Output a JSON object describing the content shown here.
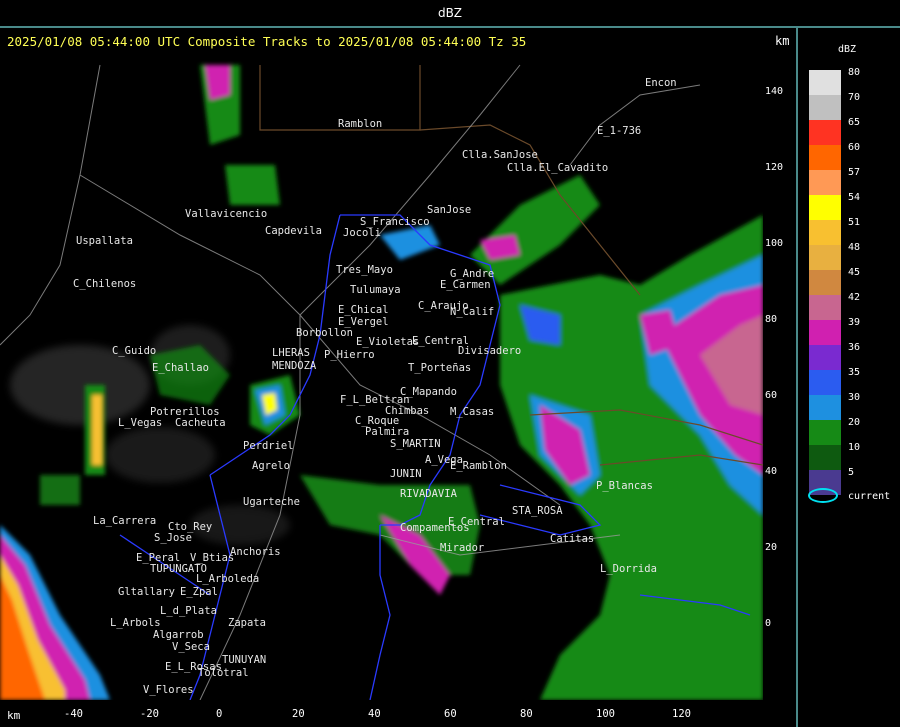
{
  "window": {
    "title": "dBZ"
  },
  "map": {
    "title": "2025/01/08 05:44:00 UTC Composite Tracks to 2025/01/08 05:44:00 Tz 35",
    "unit_label": "km",
    "x_axis_unit": "km",
    "y_ticks": [
      "140",
      "120",
      "100",
      "80",
      "60",
      "40",
      "20",
      "0"
    ],
    "x_ticks": [
      "-40",
      "-20",
      "0",
      "20",
      "40",
      "60",
      "80",
      "100",
      "120"
    ],
    "places": [
      "Ramblon",
      "Encon",
      "E_1-736",
      "Clla.SanJose",
      "Clla.El_Cavadito",
      "S_Francisco",
      "SanJose",
      "Uspallata",
      "Vallavicencio",
      "Capdevila",
      "Jocoli",
      "Tres_Mayo",
      "G_Andre",
      "E_Carmen",
      "Tulumaya",
      "C_Chilenos",
      "E_Chical",
      "E_Vergel",
      "C_Araujo",
      "N_Calif",
      "Borbollon",
      "E_Violetas",
      "E_Central",
      "Divisadero",
      "C_Guido",
      "LHERAS",
      "P_Hierro",
      "E_Challao",
      "MENDOZA",
      "T_Porteñas",
      "C_Mapando",
      "F_L_Beltran",
      "Potrerillos",
      "Chimbas",
      "M_Casas",
      "L_Vegas",
      "Cacheuta",
      "C_Roque",
      "Palmira",
      "Perdriel",
      "S_MARTIN",
      "Agrelo",
      "A_Vega",
      "E_Ramblon",
      "JUNIN",
      "P_Blancas",
      "RIVADAVIA",
      "Ugarteche",
      "La_Carrera",
      "Cto_Rey",
      "S_Jose",
      "STA_ROSA",
      "Compamentos",
      "E_Central",
      "Catitas",
      "E_Peral",
      "V_Btias",
      "Anchoris",
      "Mirador",
      "TUPUNGATO",
      "L_Arboleda",
      "L_Dorrida",
      "Gltallary",
      "E_Zpal",
      "L_d_Plata",
      "L_Arbols",
      "Zapata",
      "Algarrob",
      "V_Seca",
      "Tolotral",
      "E_L_Rosas",
      "TUNUYAN",
      "V_Flores"
    ]
  },
  "legend": {
    "title": "dBZ",
    "levels": [
      {
        "value": "80",
        "color": "#e0e0e0"
      },
      {
        "value": "70",
        "color": "#c0c0c0"
      },
      {
        "value": "65",
        "color": "#ff3322"
      },
      {
        "value": "60",
        "color": "#ff6600"
      },
      {
        "value": "57",
        "color": "#ff9955"
      },
      {
        "value": "54",
        "color": "#ffff00"
      },
      {
        "value": "51",
        "color": "#f8c030"
      },
      {
        "value": "48",
        "color": "#e8b040"
      },
      {
        "value": "45",
        "color": "#d08840"
      },
      {
        "value": "42",
        "color": "#c86690"
      },
      {
        "value": "39",
        "color": "#d020b0"
      },
      {
        "value": "36",
        "color": "#7a2ad0"
      },
      {
        "value": "35",
        "color": "#2b5cf0"
      },
      {
        "value": "30",
        "color": "#1e90e0"
      },
      {
        "value": "20",
        "color": "#168a16"
      },
      {
        "value": "10",
        "color": "#0e5a10"
      },
      {
        "value": "5",
        "color": "#4a3a90"
      }
    ],
    "current_label": "current"
  }
}
